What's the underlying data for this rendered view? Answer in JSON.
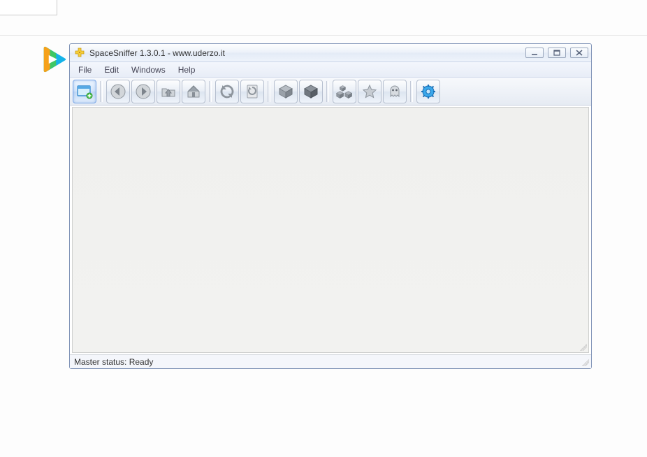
{
  "window": {
    "title": "SpaceSniffer 1.3.0.1 - www.uderzo.it"
  },
  "menus": {
    "file": "File",
    "edit": "Edit",
    "windows": "Windows",
    "help": "Help"
  },
  "toolbar": {
    "new_view": "new-view",
    "back": "back",
    "forward": "forward",
    "go_up": "go-up",
    "go_home": "go-home",
    "refresh": "refresh",
    "refresh_view": "refresh-view",
    "zoom_less": "zoom-less",
    "zoom_more": "zoom-more",
    "classes": "file-classes",
    "favorites": "favorites",
    "ghost": "ghost-filter",
    "settings": "settings"
  },
  "status": {
    "text": "Master status: Ready"
  }
}
